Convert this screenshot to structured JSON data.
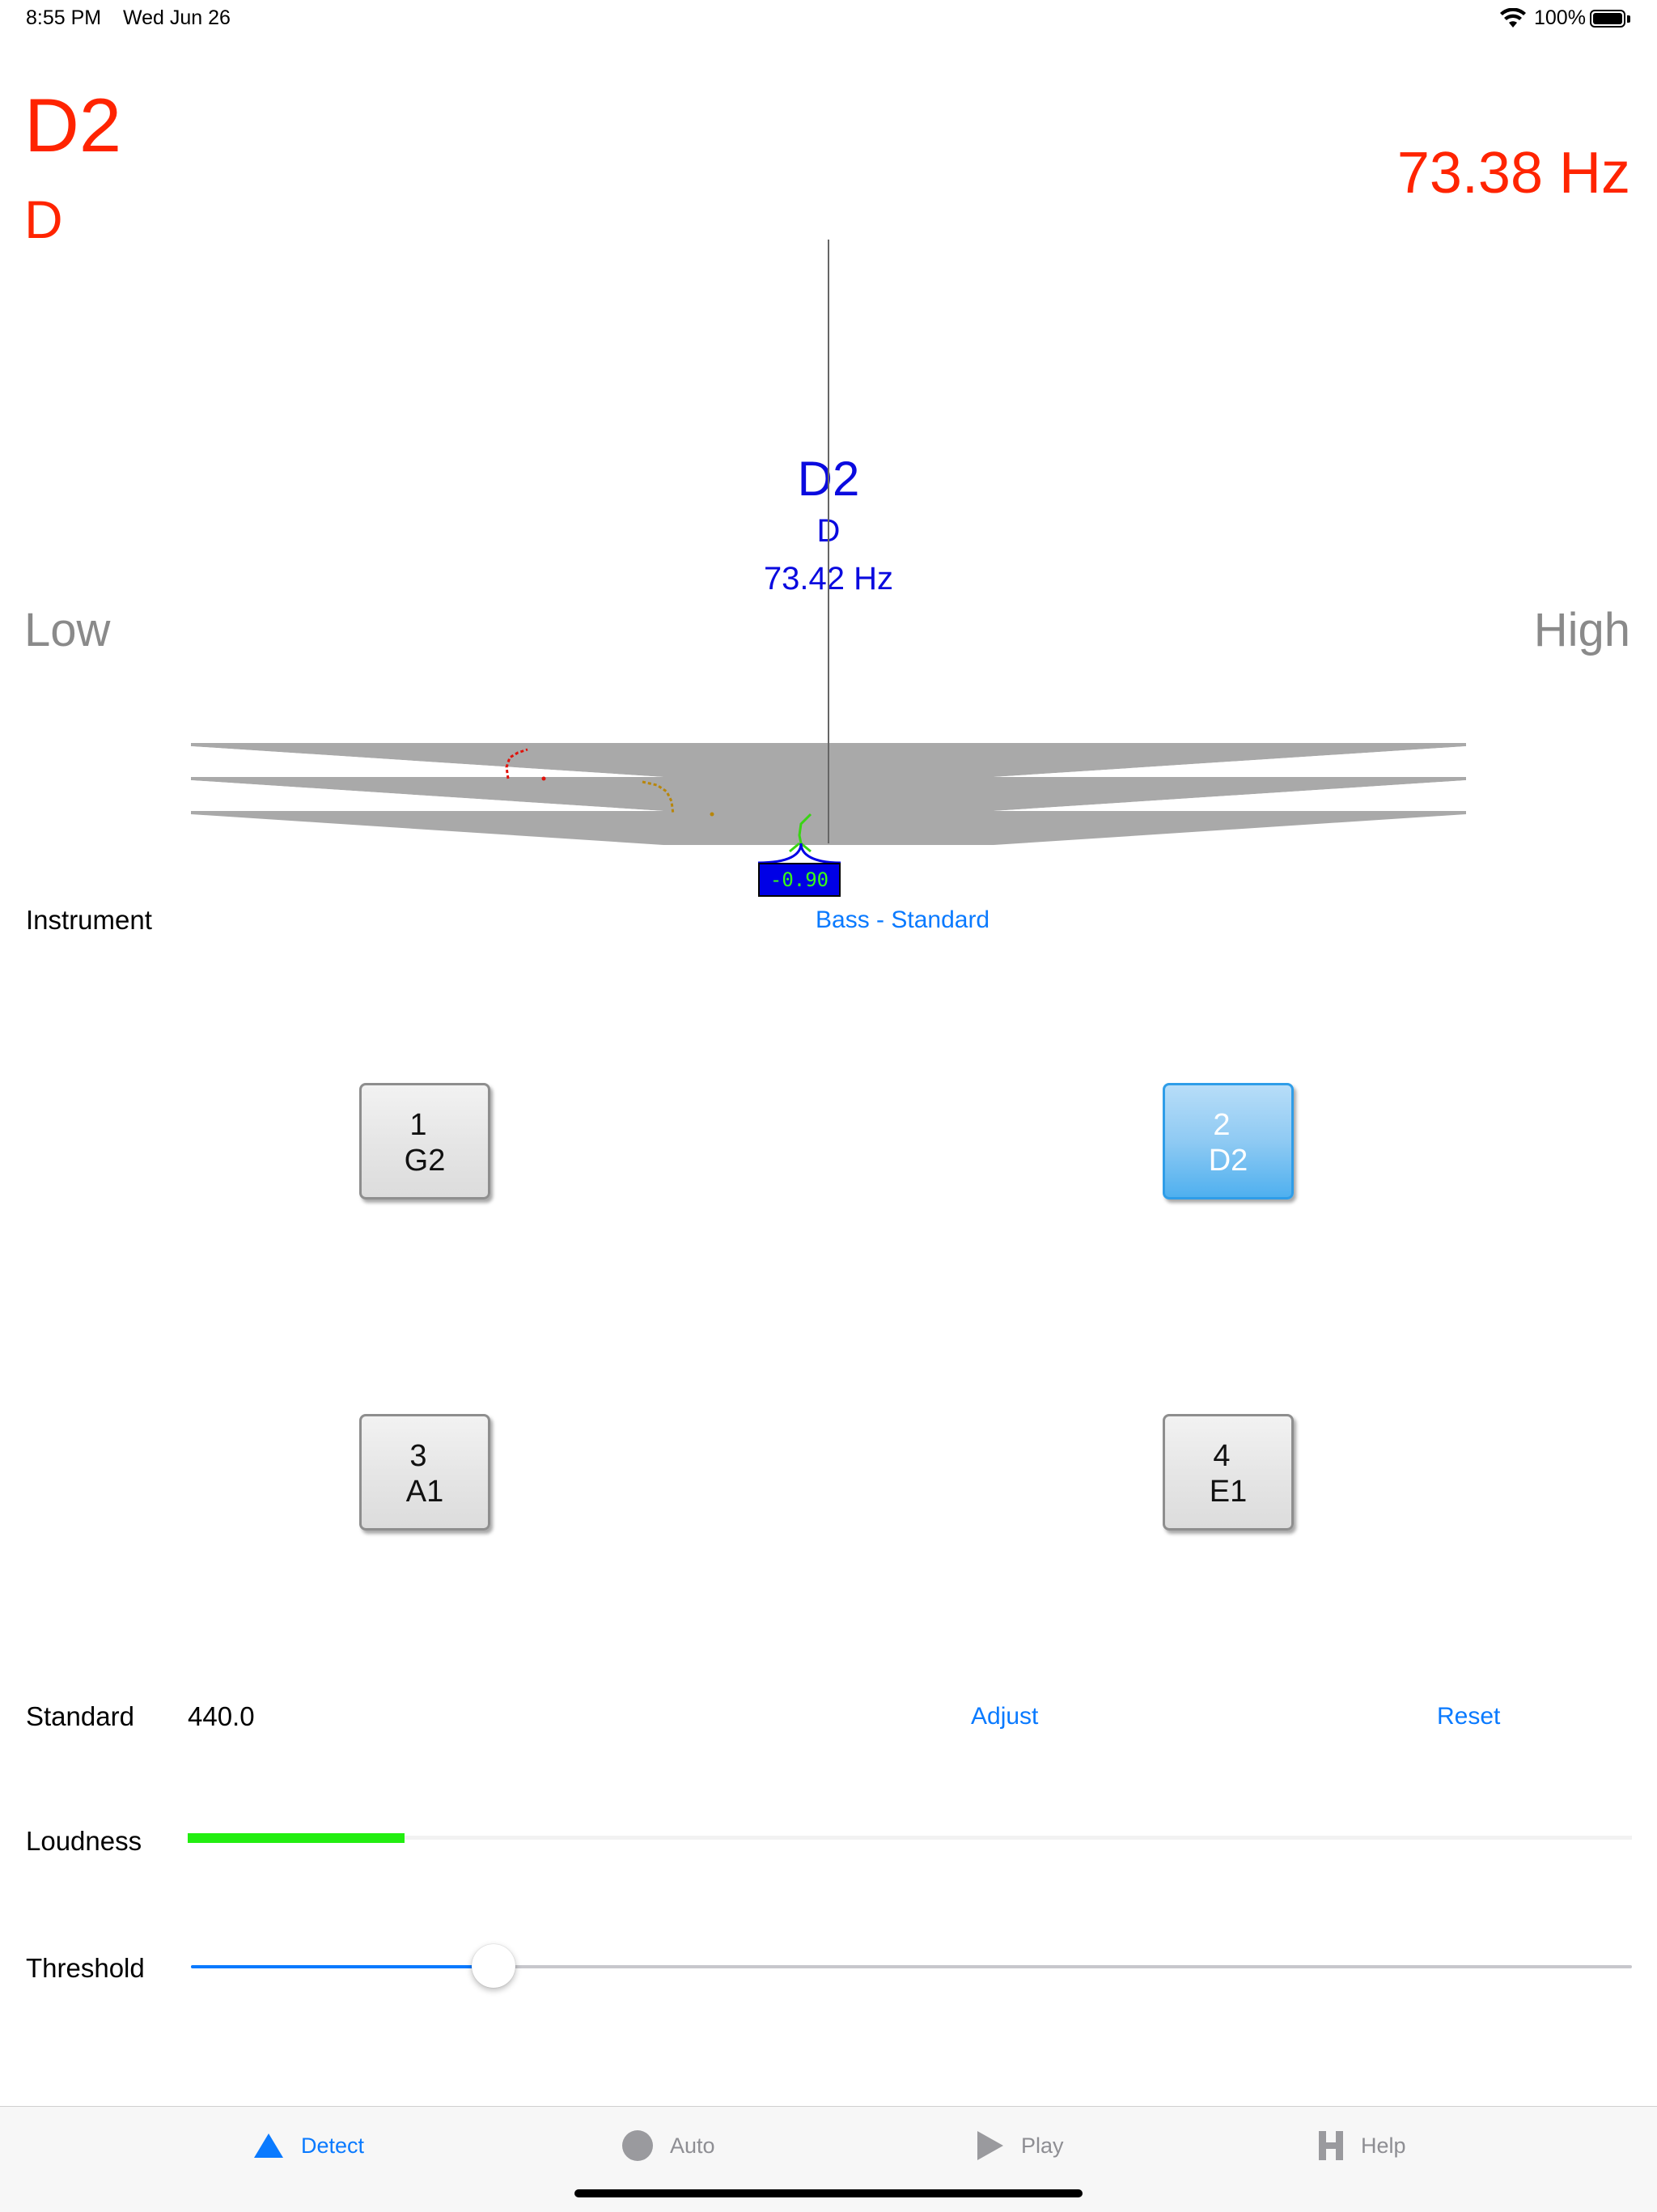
{
  "status_bar": {
    "time": "8:55 PM",
    "date": "Wed Jun 26",
    "battery": "100%",
    "icons": [
      "wifi-icon",
      "battery-icon"
    ]
  },
  "detected": {
    "note": "D2",
    "name": "D",
    "frequency": "73.38 Hz"
  },
  "scale": {
    "low_label": "Low",
    "high_label": "High"
  },
  "target": {
    "note": "D2",
    "name": "D",
    "frequency": "73.42 Hz",
    "cents": "-0.90"
  },
  "instrument": {
    "label": "Instrument",
    "value": "Bass - Standard"
  },
  "strings": [
    {
      "number": "1",
      "note": "G2",
      "selected": false
    },
    {
      "number": "2",
      "note": "D2",
      "selected": true
    },
    {
      "number": "3",
      "note": "A1",
      "selected": false
    },
    {
      "number": "4",
      "note": "E1",
      "selected": false
    }
  ],
  "standard": {
    "label": "Standard",
    "value": "440.0",
    "adjust_label": "Adjust",
    "reset_label": "Reset"
  },
  "loudness": {
    "label": "Loudness",
    "level": 0.15
  },
  "threshold": {
    "label": "Threshold",
    "level": 0.21
  },
  "tabs": [
    {
      "label": "Detect",
      "icon": "triangle-icon",
      "active": true
    },
    {
      "label": "Auto",
      "icon": "circle-icon",
      "active": false
    },
    {
      "label": "Play",
      "icon": "play-icon",
      "active": false
    },
    {
      "label": "Help",
      "icon": "h-icon",
      "active": false
    }
  ],
  "colors": {
    "detected": "#ff2400",
    "target": "#0a0adf",
    "accent": "#0a7aff",
    "loudness": "#22ee10",
    "gauge": "#a9a9a9"
  }
}
